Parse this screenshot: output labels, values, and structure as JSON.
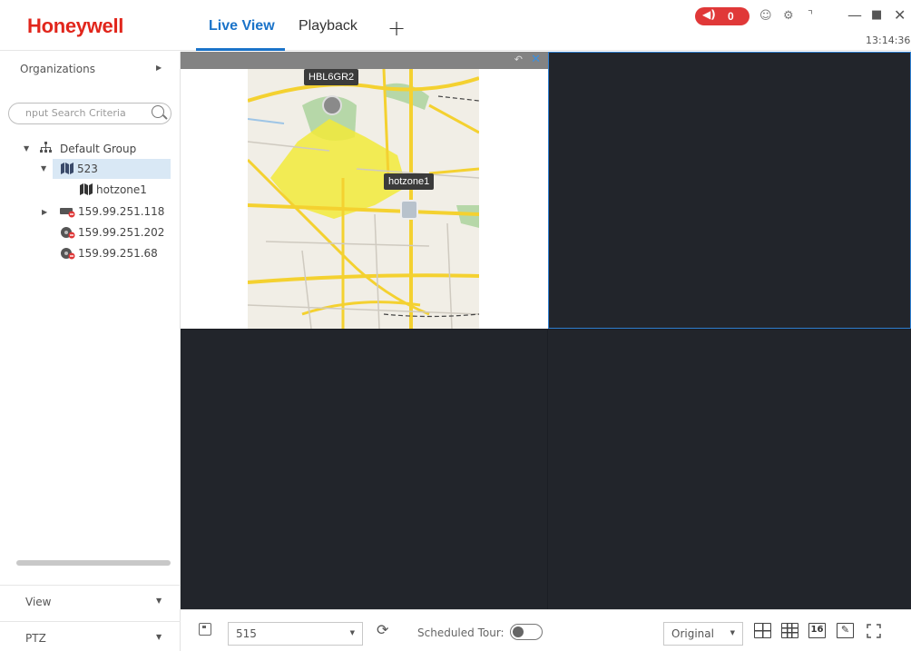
{
  "header": {
    "brand": "Honeywell",
    "tabs": [
      {
        "label": "Live View",
        "active": true
      },
      {
        "label": "Playback",
        "active": false
      }
    ],
    "add_tab": "+",
    "alarm_count": "0",
    "clock": "13:14:36",
    "icons": [
      "speaker-icon",
      "user-icon",
      "gear-icon",
      "gauge-icon",
      "minimize-icon",
      "maximize-icon",
      "close-icon"
    ],
    "accent_color": "#1a73c9",
    "brand_color": "#e1261c",
    "alarm_color": "#e03838"
  },
  "sidebar": {
    "organizations_label": "Organizations",
    "search_placeholder": "nput Search Criteria",
    "tree": [
      {
        "label": "Default Group",
        "type": "group",
        "expanded": true
      },
      {
        "label": "523",
        "type": "map",
        "selected": true,
        "expanded": true
      },
      {
        "label": "hotzone1",
        "type": "map"
      },
      {
        "label": "159.99.251.118",
        "type": "device-offline",
        "collapsed": true
      },
      {
        "label": "159.99.251.202",
        "type": "camera-offline"
      },
      {
        "label": "159.99.251.68",
        "type": "camera-offline"
      }
    ],
    "view_label": "View",
    "ptz_label": "PTZ"
  },
  "map_view": {
    "markers": [
      {
        "label": "HBL6GR2",
        "kind": "camera"
      },
      {
        "label": "hotzone1",
        "kind": "hotzone"
      }
    ]
  },
  "toolbar": {
    "view_selector": "515",
    "scheduled_tour_label": "Scheduled Tour:",
    "scheduled_tour_on": false,
    "stream_selector": "Original",
    "layout_16_label": "16"
  }
}
